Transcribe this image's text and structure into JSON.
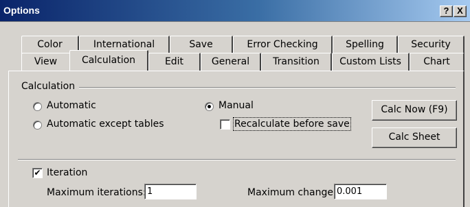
{
  "window": {
    "title": "Options",
    "help_label": "?",
    "close_label": "X"
  },
  "tabs": {
    "row1": [
      "Color",
      "International",
      "Save",
      "Error Checking",
      "Spelling",
      "Security"
    ],
    "row2": [
      "View",
      "Calculation",
      "Edit",
      "General",
      "Transition",
      "Custom Lists",
      "Chart"
    ],
    "active": "Calculation"
  },
  "calculation": {
    "group_label": "Calculation",
    "options": {
      "automatic": "Automatic",
      "automatic_except_tables": "Automatic except tables",
      "manual": "Manual"
    },
    "selected": "Manual",
    "recalc_before_save": {
      "label": "Recalculate before save",
      "checked": false
    },
    "calc_now_button": "Calc Now (F9)",
    "calc_sheet_button": "Calc Sheet"
  },
  "iteration": {
    "label": "Iteration",
    "checked": true,
    "check_mark": "✔",
    "max_iterations_label": "Maximum iterations:",
    "max_iterations_value": "1",
    "max_change_label": "Maximum change:",
    "max_change_value": "0.001"
  }
}
